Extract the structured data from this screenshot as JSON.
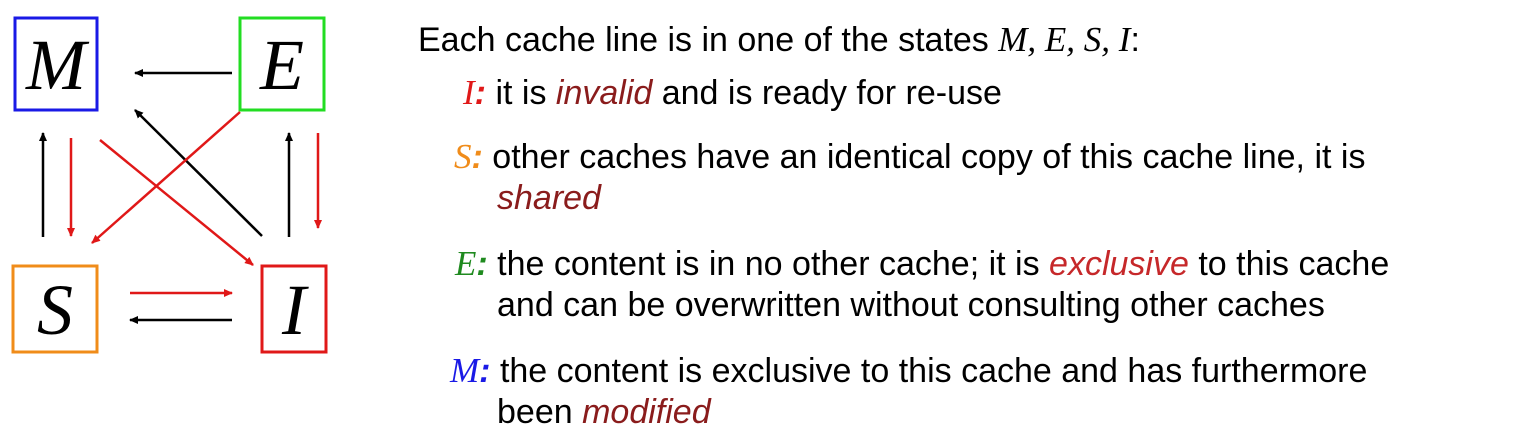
{
  "states": [
    {
      "id": "M",
      "label": "M",
      "color": "#1a1ae6"
    },
    {
      "id": "E",
      "label": "E",
      "color": "#22dd22"
    },
    {
      "id": "S",
      "label": "S",
      "color": "#f08c1a"
    },
    {
      "id": "I",
      "label": "I",
      "color": "#e01818"
    }
  ],
  "intro": {
    "prefix": "Each cache line is in one of the states ",
    "states": "M, E, S, I",
    "suffix": ":"
  },
  "items": [
    {
      "key": "I",
      "key_color": "#e01818",
      "lines": [
        {
          "pre": "it is ",
          "em": "invalid",
          "post": " and is ready for re-use"
        }
      ]
    },
    {
      "key": "S",
      "key_color": "#f08c1a",
      "lines": [
        {
          "pre": "other caches have an identical copy of this cache line, it is",
          "em": "",
          "post": ""
        },
        {
          "pre": "",
          "em": "shared",
          "post": ""
        }
      ]
    },
    {
      "key": "E",
      "key_color": "#1f8a1f",
      "lines": [
        {
          "pre": "the content is in no other cache; it is ",
          "em": "exclusive",
          "post": " to this cache"
        },
        {
          "pre": "and can be overwritten without consulting other caches",
          "em": "",
          "post": ""
        }
      ]
    },
    {
      "key": "M",
      "key_color": "#1a1ae6",
      "lines": [
        {
          "pre": "the content is exclusive to this cache and has furthermore",
          "em": "",
          "post": ""
        },
        {
          "pre": "been ",
          "em": "modified",
          "post": ""
        }
      ]
    }
  ],
  "colors": {
    "arrow_black": "#000000",
    "arrow_red": "#e01818",
    "emphasis": "#8a1c1c"
  }
}
